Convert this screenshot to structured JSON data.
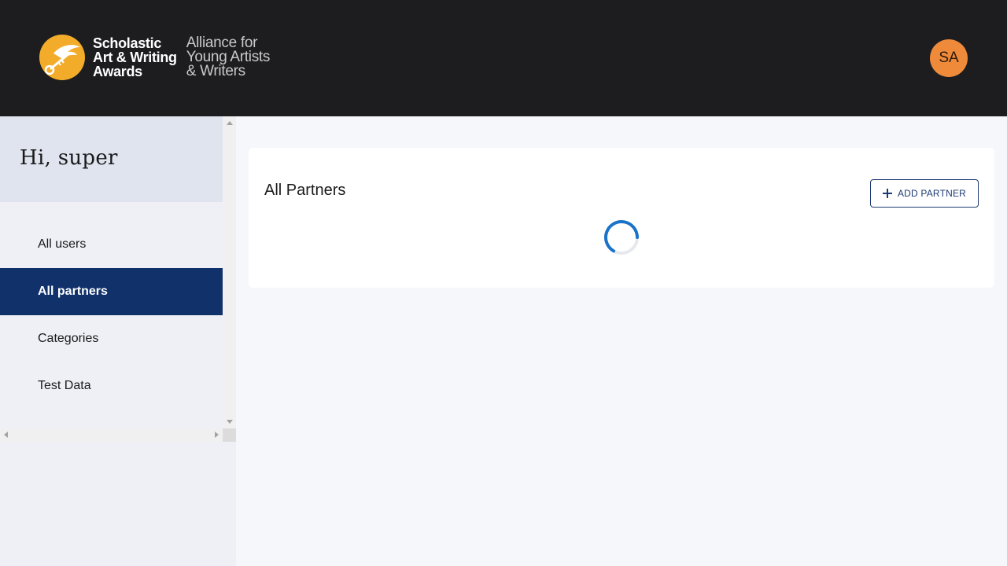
{
  "header": {
    "logo": {
      "line1": "Scholastic",
      "line2": "Art & Writing",
      "line3": "Awards",
      "sub1": "Alliance for",
      "sub2": "Young Artists",
      "sub3": "& Writers"
    },
    "avatar_initials": "SA"
  },
  "sidebar": {
    "greeting": "Hi, super",
    "items": [
      {
        "label": "All users",
        "active": false
      },
      {
        "label": "All partners",
        "active": true
      },
      {
        "label": "Categories",
        "active": false
      },
      {
        "label": "Test Data",
        "active": false
      }
    ]
  },
  "main": {
    "title": "All Partners",
    "add_button_label": "ADD PARTNER",
    "loading": true
  },
  "colors": {
    "header_bg": "#1d1d20",
    "logo_accent": "#f2ac2a",
    "avatar_bg": "#ef8a3b",
    "nav_active_bg": "#11316b",
    "button_color": "#1c3a73",
    "spinner_color": "#1a73c8"
  },
  "icons": {
    "logo": "key-wing-logo-icon",
    "add": "plus-icon",
    "loading": "spinner-icon"
  }
}
